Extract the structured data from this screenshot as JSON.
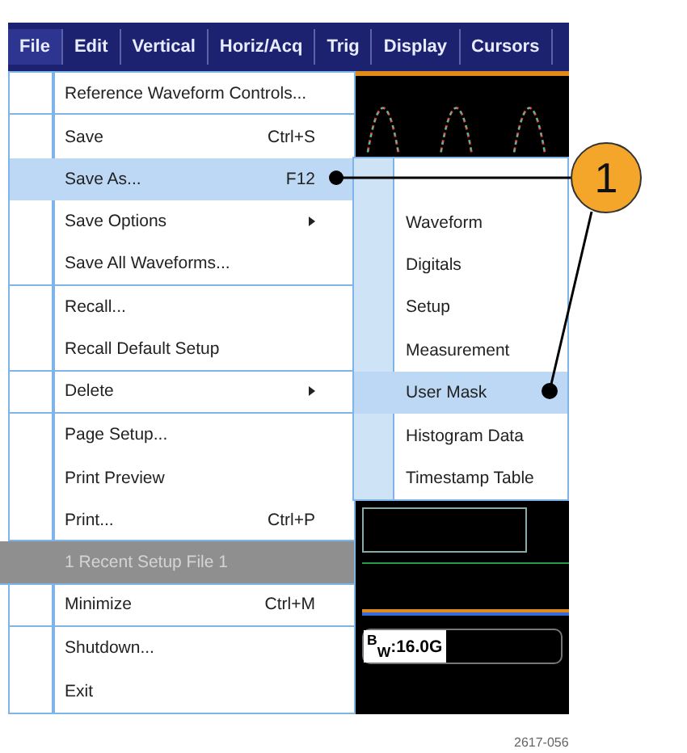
{
  "menu_bar": [
    {
      "label": "File",
      "selected": true
    },
    {
      "label": "Edit",
      "selected": false
    },
    {
      "label": "Vertical",
      "selected": false
    },
    {
      "label": "Horiz/Acq",
      "selected": false
    },
    {
      "label": "Trig",
      "selected": false
    },
    {
      "label": "Display",
      "selected": false
    },
    {
      "label": "Cursors",
      "selected": false
    }
  ],
  "file_menu": [
    {
      "label": "Reference Waveform Controls...",
      "submenu": false,
      "selected": false,
      "disabled": false,
      "separator_after": true
    },
    {
      "label": "Save",
      "shortcut": "Ctrl+S",
      "submenu": false,
      "selected": false,
      "disabled": false,
      "separator_after": false
    },
    {
      "label": "Save As...",
      "shortcut": "F12",
      "submenu": false,
      "selected": true,
      "disabled": false,
      "separator_after": false
    },
    {
      "label": "Save Options",
      "submenu": true,
      "selected": false,
      "disabled": false,
      "separator_after": false
    },
    {
      "label": "Save All Waveforms...",
      "submenu": false,
      "selected": false,
      "disabled": false,
      "separator_after": true
    },
    {
      "label": "Recall...",
      "submenu": false,
      "selected": false,
      "disabled": false,
      "separator_after": false
    },
    {
      "label": "Recall Default Setup",
      "submenu": false,
      "selected": false,
      "disabled": false,
      "separator_after": true
    },
    {
      "label": "Delete",
      "submenu": true,
      "selected": false,
      "disabled": false,
      "separator_after": true
    },
    {
      "label": "Page Setup...",
      "submenu": false,
      "selected": false,
      "disabled": false,
      "separator_after": false
    },
    {
      "label": "Print Preview",
      "submenu": false,
      "selected": false,
      "disabled": false,
      "separator_after": false
    },
    {
      "label": "Print...",
      "shortcut": "Ctrl+P",
      "submenu": false,
      "selected": false,
      "disabled": false,
      "separator_after": true
    },
    {
      "label": "1 Recent Setup File 1",
      "submenu": false,
      "selected": false,
      "disabled": true,
      "separator_after": true
    },
    {
      "label": "Minimize",
      "shortcut": "Ctrl+M",
      "submenu": false,
      "selected": false,
      "disabled": false,
      "separator_after": true
    },
    {
      "label": "Shutdown...",
      "submenu": false,
      "selected": false,
      "disabled": false,
      "separator_after": false
    },
    {
      "label": "Exit",
      "submenu": false,
      "selected": false,
      "disabled": false,
      "separator_after": false
    }
  ],
  "save_as_submenu": [
    {
      "label": "Waveform",
      "selected": false
    },
    {
      "label": "Digitals",
      "selected": false
    },
    {
      "label": "Setup",
      "selected": false
    },
    {
      "label": "Measurement",
      "selected": false
    },
    {
      "label": "User Mask",
      "selected": true
    },
    {
      "label": "Histogram Data",
      "selected": false
    },
    {
      "label": "Timestamp Table",
      "selected": false
    }
  ],
  "bandwidth_readout": "$^{B}$$_{W}$:16.0G",
  "callout": {
    "number": "1"
  },
  "figure_id": "2617-056"
}
